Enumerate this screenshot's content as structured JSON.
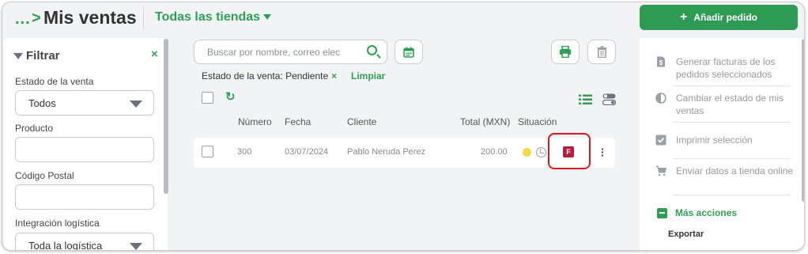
{
  "header": {
    "breadcrumb_ellipsis": "...",
    "breadcrumb_arrow": ">",
    "title": "Mis ventas",
    "store_select": "Todas las tiendas",
    "add_order_label": "Añadir pedido",
    "add_order_plus": "+"
  },
  "filters": {
    "title": "Filtrar",
    "close": "×",
    "sale_status_label": "Estado de la venta",
    "sale_status_value": "Todos",
    "product_label": "Producto",
    "product_value": "",
    "postal_code_label": "Código Postal",
    "postal_code_value": "",
    "logistics_label": "Integración logística",
    "logistics_value": "Toda la logística"
  },
  "toolbar": {
    "search_placeholder": "Buscar por nombre, correo elec",
    "active_filter": "Estado de la venta: Pendiente",
    "active_filter_remove": "×",
    "clear_label": "Limpiar"
  },
  "table": {
    "columns": [
      "Número",
      "Fecha",
      "Cliente",
      "Total (MXN)",
      "Situación"
    ],
    "rows": [
      {
        "number": "300",
        "date": "03/07/2024",
        "client": "Pablo Neruda Perez",
        "total": "200.00",
        "status_color": "#f0d84a",
        "invoice_badge": "F"
      }
    ]
  },
  "actions": {
    "items": [
      {
        "label": "Generar facturas de los pedidos seleccionados",
        "icon": "invoice-icon"
      },
      {
        "label": "Cambiar el estado de mis ventas",
        "icon": "half-circle-icon"
      },
      {
        "label": "Imprimir selección",
        "icon": "checkbox-icon"
      },
      {
        "label": "Enviar datos a tienda online",
        "icon": "cart-icon"
      }
    ],
    "more_actions": "Más acciones",
    "export": "Exportar"
  },
  "colors": {
    "accent": "#2f9e55",
    "highlight": "#e0141f",
    "invoice_badge": "#b31e3a"
  }
}
